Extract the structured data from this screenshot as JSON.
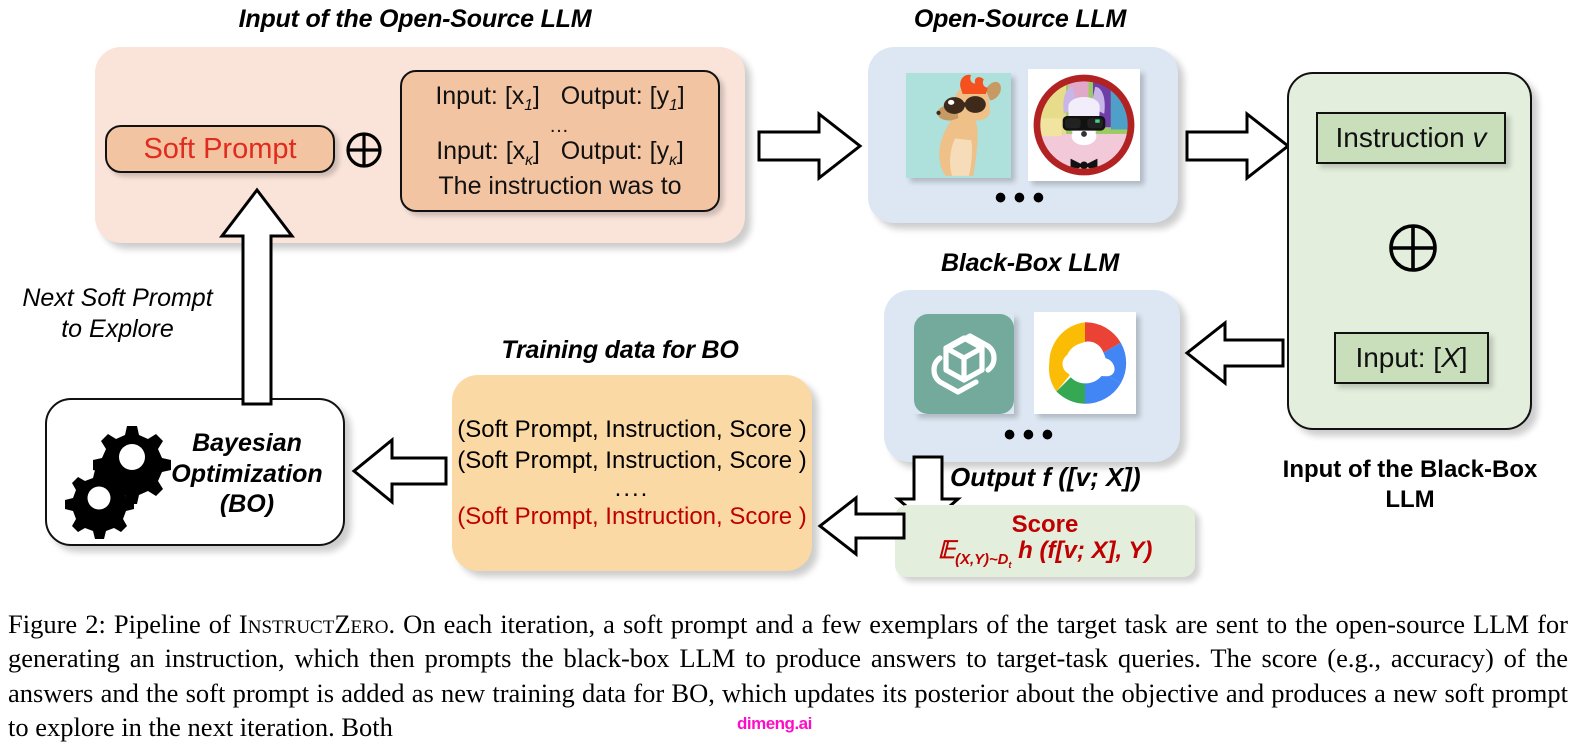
{
  "titles": {
    "open_source_input": "Input of the Open-Source LLM",
    "open_source_llm": "Open-Source  LLM",
    "black_box_llm": "Black-Box LLM",
    "training_data": "Training data for BO",
    "black_box_input_l1": "Input of the Black-Box",
    "black_box_input_l2": "LLM"
  },
  "open_source_input": {
    "soft_prompt_label": "Soft Prompt",
    "plus_icon": "circled-plus",
    "exemplars": {
      "line1_input": "Input: [x",
      "line1_input_sub": "1",
      "line1_input_end": "]",
      "line1_output": "Output: [y",
      "line1_output_sub": "1",
      "line1_output_end": "]",
      "ellipsis": "…",
      "line2_input": "Input: [x",
      "line2_input_sub": "κ",
      "line2_input_end": "]",
      "line2_output": "Output: [y",
      "line2_output_sub": "κ",
      "line2_output_end": "]",
      "line3": "The instruction was to"
    }
  },
  "open_source_llm_box": {
    "model_icons": [
      "alpaca-icon",
      "vicuna-icon"
    ],
    "more_dots": "•••"
  },
  "black_box_llm_box": {
    "model_icons": [
      "openai-icon",
      "google-cloud-icon"
    ],
    "more_dots": "•••"
  },
  "black_box_input": {
    "instruction_label": "Instruction",
    "instruction_var": "v",
    "plus_icon": "circled-plus",
    "input_label": "Input: [",
    "input_var": "X",
    "input_label_end": "]"
  },
  "output": {
    "label_bold": "Output",
    "label_math": "f ([v; X])"
  },
  "score": {
    "title": "Score",
    "expectation": "𝔼",
    "expectation_sub": "(X,Y)~D",
    "expectation_sub2": "t",
    "formula_rest": "h (f[v; X], Y)"
  },
  "training_data_box": {
    "rows": [
      "(Soft Prompt, Instruction, Score )",
      "(Soft Prompt, Instruction, Score )",
      "....",
      "(Soft Prompt, Instruction, Score )"
    ],
    "highlight_row_index": 3,
    "highlight_color": "#C00000"
  },
  "bayesian_optimization": {
    "gears_icon": "gears-icon",
    "line1": "Bayesian",
    "line2": "Optimization",
    "line3": "(BO)"
  },
  "feedback_arrow": {
    "line1": "Next Soft Prompt",
    "line2": "to Explore"
  },
  "caption": {
    "prefix": "Figure 2:",
    "text_a": "  Pipeline of ",
    "smallcaps": "InstructZero",
    "text_b": ". On each iteration, a soft prompt and a few exemplars of the target task are sent to the open-source LLM for generating an instruction, which then prompts the black-box LLM to produce answers to target-task queries. The score (e.g., accuracy) of the answers and the soft prompt is added as new training data for BO, which updates its posterior about the objective and produces a new soft prompt to explore in the next iteration. Both"
  },
  "watermark": {
    "text": "dimeng.ai"
  },
  "colors": {
    "peach_outer": "#FAE3D9",
    "peach_inner": "#F3C4A1",
    "blue": "#DCE7F3",
    "green_outer": "#E3EEDC",
    "green_inner": "#C9DEBB",
    "orange": "#FBD9A5",
    "red_text": "#E02B20",
    "dark_red_text": "#C00000",
    "watermark": "#FF00C8"
  }
}
